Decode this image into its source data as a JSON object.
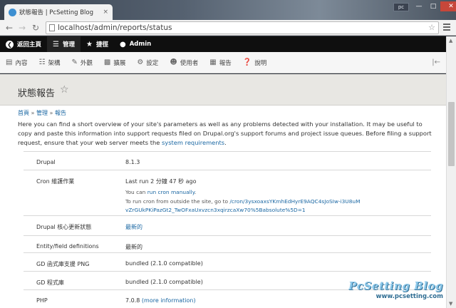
{
  "browser": {
    "tab_title": "狀態報告 | PcSetting Blog",
    "tab_close": "×",
    "window_user": "pc",
    "url": "localhost/admin/reports/status",
    "back_icon": "arrow-left-icon",
    "forward_icon": "arrow-right-icon",
    "reload_icon": "reload-icon"
  },
  "toolbar": {
    "back_site": "返回主頁",
    "manage": "管理",
    "shortcuts": "捷徑",
    "user": "Admin"
  },
  "admin_menu": [
    {
      "label": "內容",
      "icon": "content-icon"
    },
    {
      "label": "架構",
      "icon": "structure-icon"
    },
    {
      "label": "外觀",
      "icon": "appearance-icon"
    },
    {
      "label": "擴展",
      "icon": "extend-icon"
    },
    {
      "label": "設定",
      "icon": "config-icon"
    },
    {
      "label": "使用者",
      "icon": "people-icon"
    },
    {
      "label": "報告",
      "icon": "reports-icon"
    },
    {
      "label": "說明",
      "icon": "help-icon"
    }
  ],
  "page": {
    "title": "狀態報告",
    "breadcrumb": [
      "首頁",
      "管理",
      "報告"
    ],
    "breadcrumb_sep": "»",
    "intro_text": "Here you can find a short overview of your site's parameters as well as any problems detected with your installation. It may be useful to copy and paste this information into support requests filed on Drupal.org's support forums and project issue queues. Before filing a support request, ensure that your web server meets the ",
    "intro_link": "system requirements",
    "intro_end": "."
  },
  "report_rows": [
    {
      "label": "Drupal",
      "value": "8.1.3"
    },
    {
      "label": "Cron 維護作業",
      "value": "Last run 2 分鐘 47 秒 ago",
      "line2_pre": "You can ",
      "line2_link": "run cron manually",
      "line2_post": ".",
      "line3_pre": "To run cron from outside the site, go to ",
      "line3_link": "/cron/3ysxoaxsYKmhEdHyrE9AQC4sJoSIw-i3U8uMvZrGUkPKiPazGt2_TwOFxaUxvzcn3xqirzcaXw70%5Babsolute%5D=1"
    },
    {
      "label": "Drupal 核心更新狀態",
      "value": "最新的"
    },
    {
      "label": "Entity/field definitions",
      "value": "最新的"
    },
    {
      "label": "GD 函式庫支援 PNG",
      "value": "bundled (2.1.0 compatible)"
    },
    {
      "label": "GD 程式庫",
      "value": "bundled (2.1.0 compatible)"
    },
    {
      "label": "PHP",
      "value": "7.0.8",
      "value_link": "(more information)"
    }
  ],
  "watermark": {
    "title": "PcSetting Blog",
    "url": "www.pcsetting.com"
  }
}
